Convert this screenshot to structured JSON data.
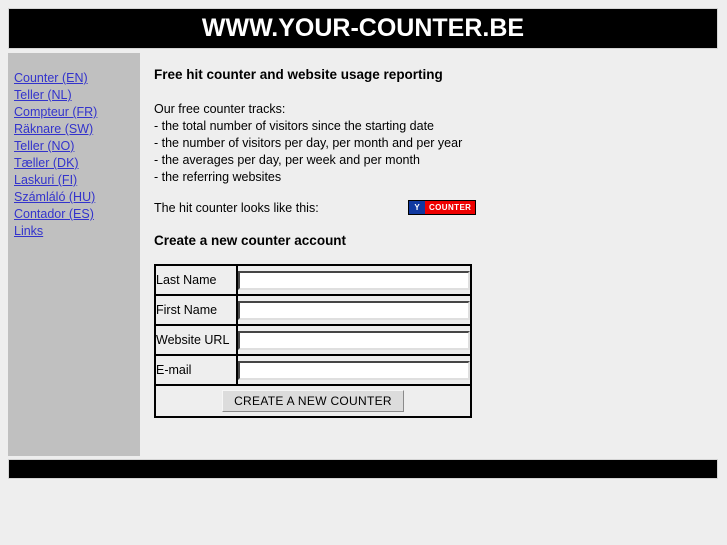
{
  "header": {
    "title": "WWW.YOUR-COUNTER.BE"
  },
  "sidebar": {
    "items": [
      {
        "label": "Counter (EN)"
      },
      {
        "label": "Teller (NL)"
      },
      {
        "label": "Compteur (FR)"
      },
      {
        "label": "Räknare (SW)"
      },
      {
        "label": "Teller (NO)"
      },
      {
        "label": "Tæller (DK)"
      },
      {
        "label": "Laskuri (FI)"
      },
      {
        "label": "Számláló (HU)"
      },
      {
        "label": "Contador (ES)"
      },
      {
        "label": "Links"
      }
    ]
  },
  "content": {
    "heading": "Free hit counter and website usage reporting",
    "intro": "Our free counter tracks:",
    "features": [
      "- the total number of visitors since the starting date",
      "- the number of visitors per day, per month and per year",
      "- the averages per day, per week and per month",
      "- the referring websites"
    ],
    "sample_text": "The hit counter looks like this:",
    "badge": {
      "left_text": "Y",
      "right_text": "COUNTER",
      "left_color": "#1038a0",
      "right_color": "#ee0000"
    },
    "form_heading": "Create a new counter account"
  },
  "form": {
    "fields": [
      {
        "label": "Last Name",
        "value": "",
        "placeholder": ""
      },
      {
        "label": "First Name",
        "value": "",
        "placeholder": ""
      },
      {
        "label": "Website URL",
        "value": "",
        "placeholder": ""
      },
      {
        "label": "E-mail",
        "value": "",
        "placeholder": ""
      }
    ],
    "submit_label": "CREATE A NEW COUNTER"
  },
  "colors": {
    "bar": "#000000",
    "sidebar": "#c0c0c0",
    "page": "#eeeeee",
    "link": "#3333cc"
  }
}
